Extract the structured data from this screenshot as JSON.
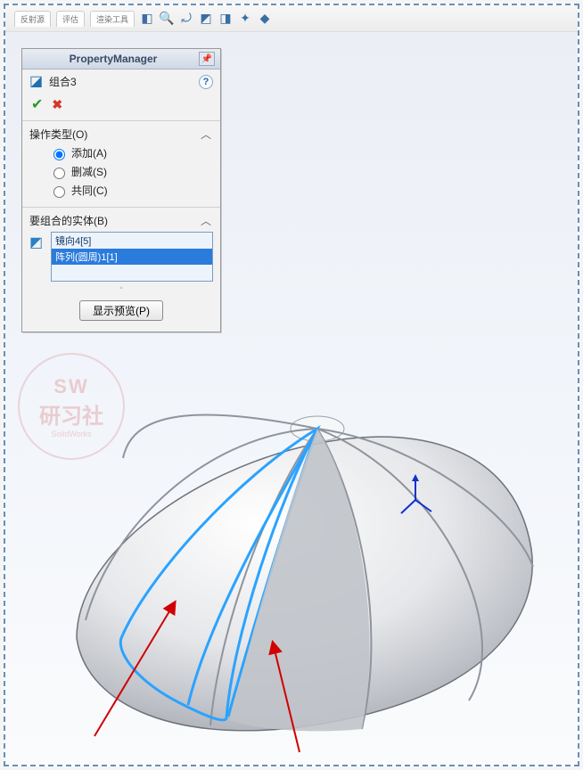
{
  "toolbar": {
    "tabs": [
      "反射源",
      "评估",
      "渲染工具"
    ]
  },
  "panel": {
    "header_title": "PropertyManager",
    "feature_name": "组合3",
    "help_label": "?",
    "section_op": {
      "title": "操作类型(O)",
      "options": {
        "add": "添加(A)",
        "subtract": "删减(S)",
        "common": "共同(C)"
      },
      "selected": "add"
    },
    "section_bodies": {
      "title": "要组合的实体(B)",
      "items": [
        "镜向4[5]",
        "阵列(圆周)1[1]"
      ],
      "selected_index": 1
    },
    "preview_button": "显示预览(P)"
  },
  "watermark": {
    "line1": "SW",
    "line2": "研习社",
    "line3": "SolidWorks"
  }
}
